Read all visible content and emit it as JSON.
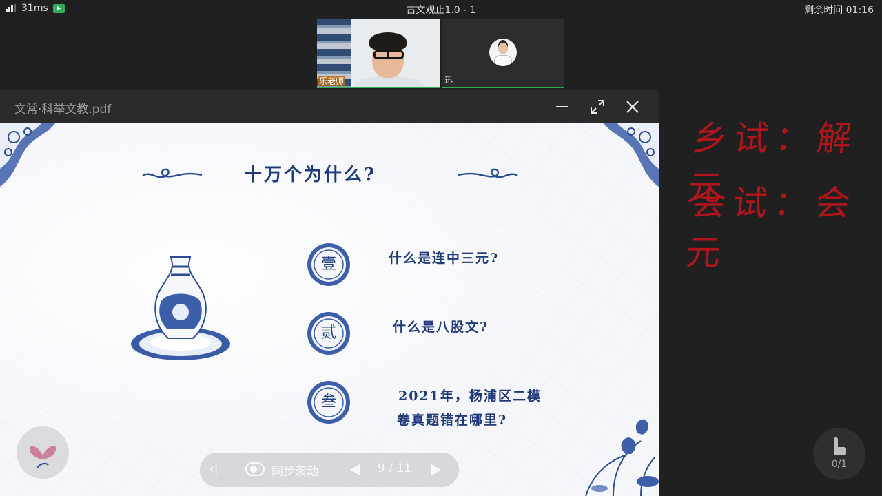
{
  "status_bar": {
    "latency": "31ms",
    "window_title": "古文观止1.0 - 1",
    "time_remaining": "剩余时间 01:16"
  },
  "video": {
    "teacher_name": "乐老师",
    "student_name": "迅"
  },
  "document": {
    "filename": "文常·科举文教.pdf",
    "slide": {
      "title": "十万个为什么?",
      "items": [
        {
          "badge": "壹",
          "lines": [
            "什么是连中三元?"
          ]
        },
        {
          "badge": "贰",
          "lines": [
            "什么是八股文?"
          ]
        },
        {
          "badge": "叁",
          "lines": [
            "2021年，杨浦区二模",
            "卷真题错在哪里?"
          ]
        }
      ]
    },
    "pager": {
      "sync_label": "同步滚动",
      "page_indicator": "9 / 11"
    }
  },
  "whiteboard": {
    "line1": "乡试：解元",
    "line2": "会试：会元",
    "hand_count": "0/1"
  },
  "colors": {
    "porcelain_blue": "#203a7a",
    "ink_red": "#b0151d",
    "active_green": "#2fae57"
  },
  "icons": [
    "signal-icon",
    "recording-icon",
    "minimize-icon",
    "maximize-icon",
    "close-icon",
    "sync-icon",
    "prev-page-icon",
    "next-page-icon",
    "raise-hand-icon"
  ]
}
